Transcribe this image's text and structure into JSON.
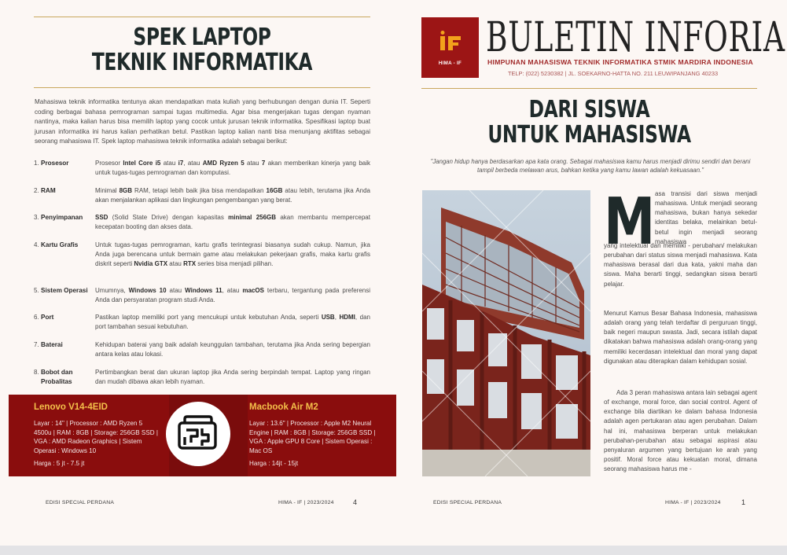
{
  "left_page": {
    "title_line1": "SPEK LAPTOP",
    "title_line2": "TEKNIK INFORMATIKA",
    "intro": "Mahasiswa teknik informatika tentunya akan mendapatkan mata kuliah yang berhubungan dengan dunia IT. Seperti coding berbagai bahasa pemrograman sampai tugas multimedia. Agar bisa mengerjakan tugas dengan nyaman nantinya, maka kalian harus bisa memilih laptop yang cocok untuk jurusan teknik informatika. Spesifikasi laptop buat jurusan informatika ini harus kalian perhatikan betul. Pastikan laptop kalian nanti bisa menunjang aktifitas sebagai seorang mahasiswa IT. Spek laptop mahasiswa teknik informatika adalah sebagai berikut:",
    "specs": [
      {
        "num": "1.",
        "name": "Prosesor",
        "desc": [
          "Prosesor ",
          {
            "b": "Intel Core i5"
          },
          " atau ",
          {
            "b": "i7"
          },
          ", atau ",
          {
            "b": "AMD Ryzen 5"
          },
          " atau ",
          {
            "b": "7"
          },
          " akan memberikan kinerja yang baik untuk tugas-tugas pemrograman dan komputasi."
        ]
      },
      {
        "num": "2.",
        "name": "RAM",
        "desc": [
          "Minimal ",
          {
            "b": "8GB"
          },
          " RAM, tetapi lebih baik jika bisa mendapatkan ",
          {
            "b": "16GB"
          },
          " atau lebih, terutama jika Anda akan menjalankan aplikasi dan lingkungan pengembangan yang berat."
        ]
      },
      {
        "num": "3.",
        "name": "Penyimpanan",
        "desc": [
          {
            "b": "SSD"
          },
          " (Solid State Drive) dengan kapasitas ",
          {
            "b": "minimal 256GB"
          },
          " akan membantu mempercepat kecepatan booting dan akses data."
        ]
      },
      {
        "num": "4.",
        "name": "Kartu Grafis",
        "desc": [
          "Untuk tugas-tugas pemrograman, kartu grafis terintegrasi biasanya sudah cukup. Namun, jika Anda juga berencana untuk bermain game atau melakukan pekerjaan grafis, maka kartu grafis diskrit seperti ",
          {
            "b": "Nvidia GTX"
          },
          " atau ",
          {
            "b": "RTX"
          },
          " series bisa menjadi pilihan."
        ]
      },
      {
        "num": "5.",
        "name": "Sistem Operasi",
        "desc": [
          "Umumnya, ",
          {
            "b": "Windows 10"
          },
          " atau ",
          {
            "b": "Windows 11"
          },
          ", atau ",
          {
            "b": "macOS"
          },
          " terbaru, tergantung pada preferensi Anda dan persyaratan program studi Anda."
        ]
      },
      {
        "num": "6.",
        "name": "Port",
        "desc": [
          "Pastikan laptop memiliki port yang mencukupi untuk kebutuhan Anda, seperti ",
          {
            "b": "USB"
          },
          ", ",
          {
            "b": "HDMI"
          },
          ", dan port tambahan sesuai kebutuhan."
        ]
      },
      {
        "num": "7.",
        "name": "Baterai",
        "desc": [
          "Kehidupan baterai yang baik adalah keunggulan tambahan, terutama jika Anda sering bepergian antara kelas atau lokasi."
        ]
      },
      {
        "num": "8.",
        "name": "Bobot dan Probalitas",
        "desc": [
          "Pertimbangkan berat dan ukuran laptop jika Anda sering berpindah tempat. Laptop yang ringan dan mudah dibawa akan lebih nyaman."
        ]
      }
    ],
    "promo": {
      "left_title": "Lenovo V14-4EID",
      "left_specs": "Layar : 14\" | Processor : AMD Ryzen 5 4500u | RAM : 8GB | Storage: 256GB SSD | VGA : AMD Radeon Graphics | Sistem Operasi : Windows 10",
      "left_price": "Harga : 5 jt - 7.5 jt",
      "right_title": "Macbook Air M2",
      "right_specs": "Layar : 13.6\" | Processor : Apple M2 Neural Engine | RAM : 8GB | Storage: 256GB SSD | VGA : Apple GPU 8 Core | Sistem Operasi : Mac OS",
      "right_price": "Harga : 14jt - 15jt"
    },
    "footer_left": "EDISI SPECIAL PERDANA",
    "footer_center": "HIMA - IF | 2023/2024",
    "page_number": "4"
  },
  "right_page": {
    "logo_text": "HIMA - IF",
    "masthead_title": "BULETIN INFORIA",
    "masthead_subtitle": "HIMPUNAN MAHASISWA TEKNIK INFORMATIKA STMIK MARDIRA INDONESIA",
    "masthead_address": "TELP: (022) 5230382 | JL. SOEKARNO-HATTA NO. 211 LEUWIPANJANG 40233",
    "title_line1": "DARI SISWA",
    "title_line2": "UNTUK MAHASISWA",
    "quote": "\"Jangan hidup hanya berdasarkan apa kata orang. Sebagai mahasiswa kamu harus menjadi dirimu sendiri dan berani tampil berbeda melawan arus, bahkan ketika yang kamu lawan adalah kekuasaan.\"",
    "dropcap": "M",
    "para1": "asa transisi dari siswa menjadi mahasiswa. Untuk menjadi seorang mahasiswa, bukan hanya sekedar identitas belaka, melainkan betul-betul ingin menjadi seorang mahasiswa yang intelektual dan memiliki - perubahan/ melakukan perubahan dari status siswa menjadi mahasiswa. Kata mahasiswa berasal dari dua kata, yakni maha dan siswa. Maha berarti tinggi, sedangkan siswa berarti pelajar.",
    "para2": "Menurut Kamus Besar Bahasa Indonesia, mahasiswa adalah orang yang telah terdaftar di perguruan tinggi, baik negeri maupun swasta. Jadi, secara istilah dapat dikatakan bahwa mahasiswa adalah orang-orang yang memiliki kecerdasan intelektual dan moral yang dapat digunakan atau diterapkan dalam kehidupan sosial.",
    "para3": "Ada 3 peran mahasiswa antara lain sebagai agent of exchange, moral force, dan social control. Agent of exchange bila diartikan ke dalam bahasa Indonesia adalah agen pertukaran atau agen perubahan. Dalam hal ini, mahasiswa berperan untuk melakukan perubahan-perubahan atau sebagai aspirasi atau penyaluran argumen yang bertujuan ke arah yang positif. Moral force atau kekuatan moral, dimana seorang mahasiswa harus me -",
    "footer_left": "EDISI SPECIAL PERDANA",
    "footer_center": "HIMA - IF | 2023/2024",
    "page_number": "1"
  },
  "colors": {
    "accent_red": "#8a0d0d",
    "promo_title": "#f4c04a",
    "gold_rule": "#c9a75d",
    "title_dark": "#1f2a2a"
  },
  "icons": [
    "hima-if-logo-icon",
    "circuit-logo-icon"
  ]
}
